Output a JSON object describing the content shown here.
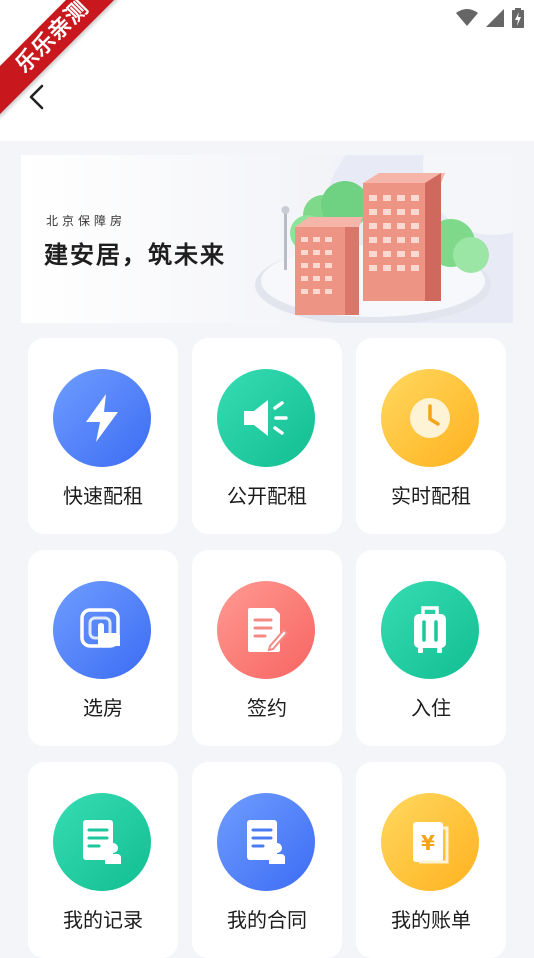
{
  "watermark": "乐乐亲测",
  "banner": {
    "subtitle": "北京保障房",
    "title": "建安居，筑未来"
  },
  "menu": [
    {
      "label": "快速配租",
      "icon": "lightning-icon",
      "color": "#4a7bf7"
    },
    {
      "label": "公开配租",
      "icon": "megaphone-icon",
      "color": "#1cc79c"
    },
    {
      "label": "实时配租",
      "icon": "clock-icon",
      "color": "#ffc132"
    },
    {
      "label": "选房",
      "icon": "tap-hand-icon",
      "color": "#4a7bf7"
    },
    {
      "label": "签约",
      "icon": "sign-document-icon",
      "color": "#f8726d"
    },
    {
      "label": "入住",
      "icon": "luggage-icon",
      "color": "#1cc79c"
    },
    {
      "label": "我的记录",
      "icon": "record-icon",
      "color": "#1cc79c"
    },
    {
      "label": "我的合同",
      "icon": "contract-icon",
      "color": "#4a7bf7"
    },
    {
      "label": "我的账单",
      "icon": "bill-icon",
      "color": "#ffc132"
    }
  ]
}
